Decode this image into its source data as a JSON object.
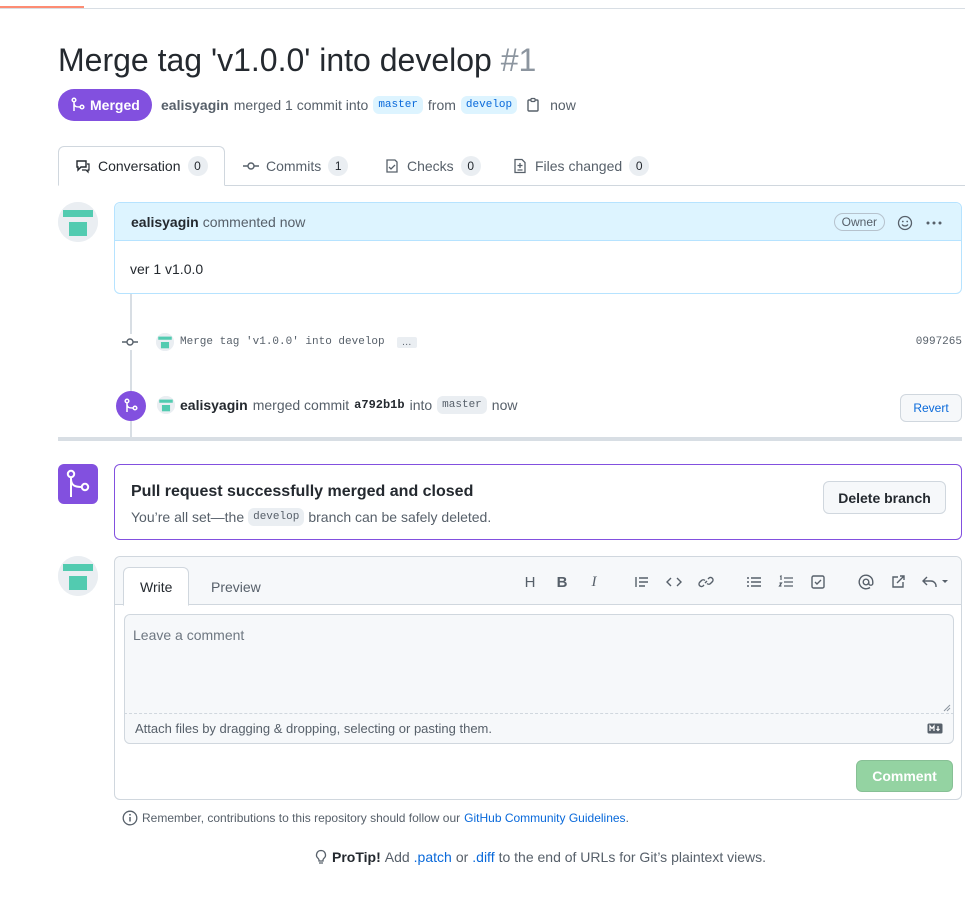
{
  "pr": {
    "title": "Merge tag 'v1.0.0' into develop",
    "number": "#1",
    "state": "Merged",
    "author": "ealisyagin",
    "merged_text": "merged 1 commit into",
    "base_branch": "master",
    "from_text": "from",
    "head_branch": "develop",
    "time": "now"
  },
  "tabs": [
    {
      "label": "Conversation",
      "count": "0"
    },
    {
      "label": "Commits",
      "count": "1"
    },
    {
      "label": "Checks",
      "count": "0"
    },
    {
      "label": "Files changed",
      "count": "0"
    }
  ],
  "comment": {
    "author": "ealisyagin",
    "action": "commented now",
    "badge": "Owner",
    "body": "ver 1 v1.0.0"
  },
  "commit": {
    "message": "Merge tag 'v1.0.0' into develop",
    "ellipsis": "…",
    "sha": "0997265"
  },
  "merge_event": {
    "author": "ealisyagin",
    "text": "merged commit",
    "sha": "a792b1b",
    "into": "into",
    "branch": "master",
    "time": "now",
    "revert_label": "Revert"
  },
  "merge_status": {
    "title": "Pull request successfully merged and closed",
    "sub_prefix": "You’re all set—the",
    "branch": "develop",
    "sub_suffix": "branch can be safely deleted.",
    "delete_label": "Delete branch"
  },
  "editor": {
    "write_tab": "Write",
    "preview_tab": "Preview",
    "placeholder": "Leave a comment",
    "attach_text": "Attach files by dragging & dropping, selecting or pasting them.",
    "submit_label": "Comment"
  },
  "footer": {
    "remember_prefix": "Remember, contributions to this repository should follow our",
    "remember_link": "GitHub Community Guidelines",
    "remember_suffix": ".",
    "protip_label": "ProTip!",
    "protip_add": "Add",
    "patch": ".patch",
    "or": "or",
    "diff": ".diff",
    "protip_rest": "to the end of URLs for Git’s plaintext views."
  },
  "colors": {
    "merged": "#8250df",
    "link": "#0969da",
    "comment_header": "#ddf4ff",
    "avatar": "#52cbb0"
  }
}
